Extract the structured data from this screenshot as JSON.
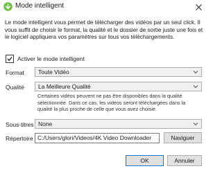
{
  "window": {
    "title": "Mode intelligent",
    "icon": "app-logo-icon",
    "close_icon": "close-icon"
  },
  "description": "Le mode intelligent vous permet de télécharger des vidéos par un seul click. Il vous suffit de choisir le format, la qualité et le dossier de sortie juste une fois et le logiciel appliquera vos paramètres sur tous vos téléchargements.",
  "smart_mode": {
    "label": "Activer le mode intelligent",
    "checked": true
  },
  "format": {
    "label": "Format",
    "value": "Toute Vidéo"
  },
  "quality": {
    "label": "Qualité",
    "value": "La Meilleure Qualité",
    "note": "Certaines vidéos peuvent ne pas être disponibles dans la qualité sélectionnée. Dans ce cas, les vidéos seront téléchargées dans la qualité la plus proche de celle que vous avez choisie."
  },
  "subtitles": {
    "label": "Sous-titres",
    "value": "None"
  },
  "directory": {
    "label": "Répertoire",
    "value": "C:/Users/glori/Videos/4K Video Downloader",
    "browse_label": "Naviguer"
  },
  "buttons": {
    "ok": "OK",
    "cancel": "Annuler"
  },
  "colors": {
    "accent": "#0078d7",
    "logo": "#6cbf3d"
  }
}
